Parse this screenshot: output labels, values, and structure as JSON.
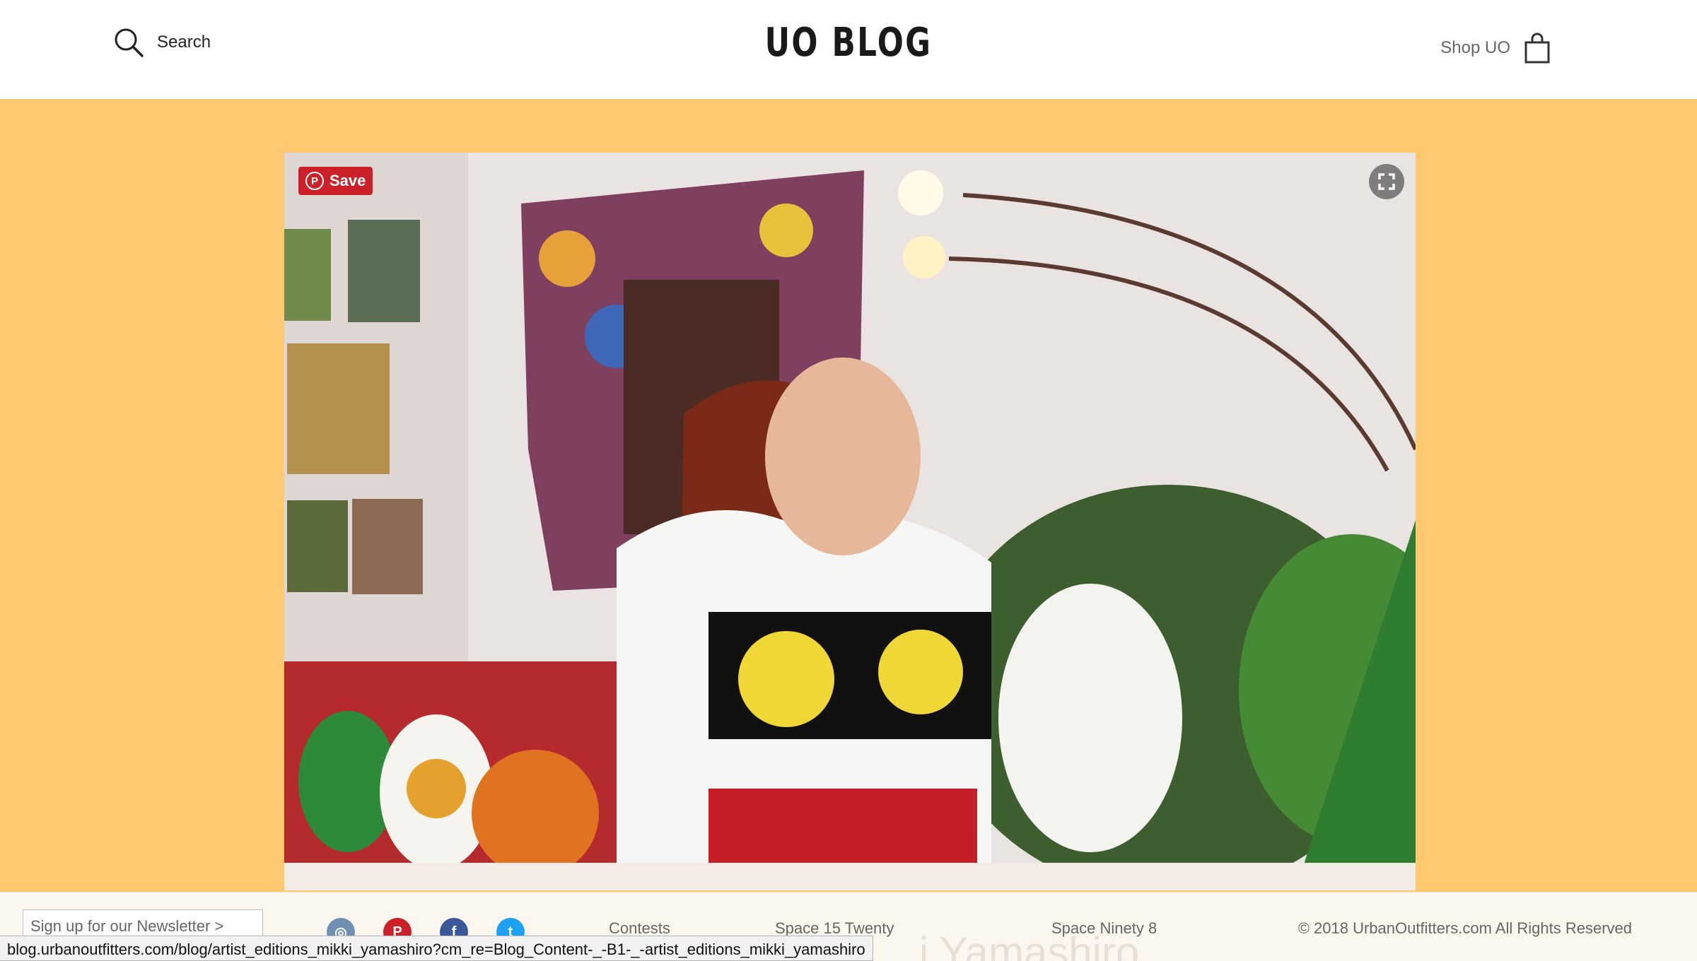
{
  "header": {
    "search_label": "Search",
    "logo": "UO BLOG",
    "shop_label": "Shop UO"
  },
  "hero": {
    "background_color": "#fec96f",
    "save_label": "Save",
    "pin_glyph": "P"
  },
  "footer": {
    "newsletter_label": "Sign up for our Newsletter >",
    "social": [
      {
        "name": "instagram-icon",
        "glyph": "◎",
        "color": "#6f8fb5"
      },
      {
        "name": "pinterest-icon",
        "glyph": "P",
        "color": "#cb2027"
      },
      {
        "name": "facebook-icon",
        "glyph": "f",
        "color": "#3b5998"
      },
      {
        "name": "twitter-icon",
        "glyph": "t",
        "color": "#1da1f2"
      }
    ],
    "links": [
      "Contests",
      "Space 15 Twenty",
      "Space Ninety 8"
    ],
    "copyright": "© 2018 UrbanOutfitters.com All Rights Reserved",
    "ghost_title": "i Yamashiro"
  },
  "status_bar": {
    "url": "blog.urbanoutfitters.com/blog/artist_editions_mikki_yamashiro?cm_re=Blog_Content-_-B1-_-artist_editions_mikki_yamashiro"
  }
}
